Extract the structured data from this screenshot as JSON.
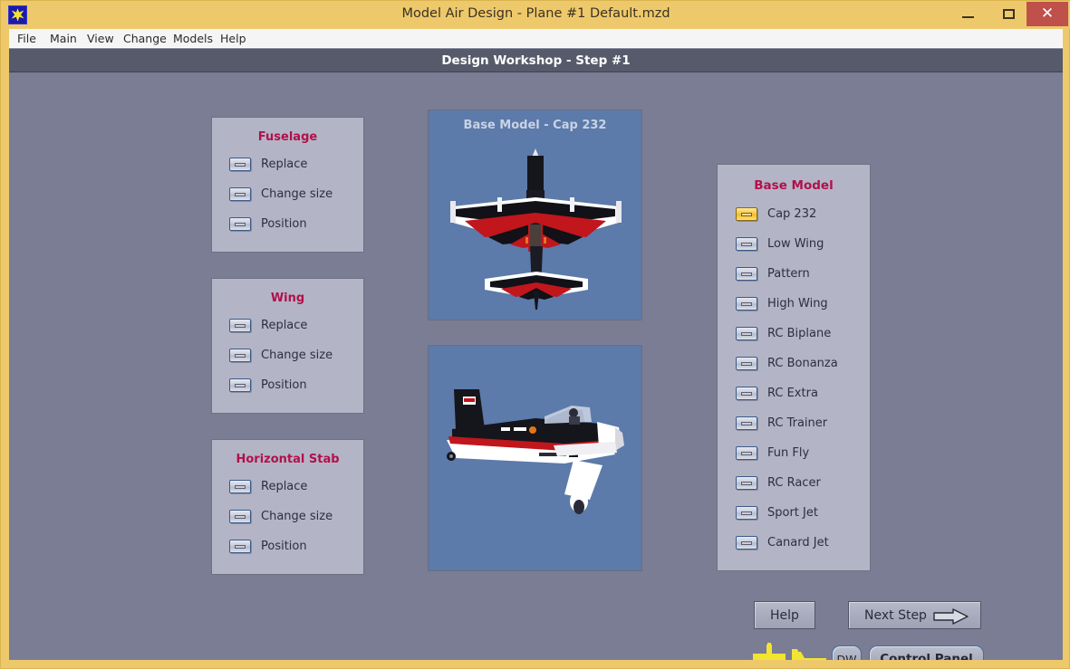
{
  "window": {
    "title": "Model Air Design - Plane #1  Default.mzd",
    "app_icon": "airplane-icon",
    "minimize_label": "Minimize",
    "maximize_label": "Maximize",
    "close_label": "Close",
    "frame_color": "#eec96b",
    "close_button_color": "#c0504a"
  },
  "menubar": {
    "items": [
      {
        "label": "File"
      },
      {
        "label": "Main"
      },
      {
        "label": "View"
      },
      {
        "label": "Change"
      },
      {
        "label": "Models"
      },
      {
        "label": "Help"
      }
    ]
  },
  "step_header": {
    "text": "Design Workshop  -  Step #1",
    "background": "#565a6b"
  },
  "groups": [
    {
      "title": "Fuselage",
      "title_color": "#b2104b",
      "options": [
        {
          "label": "Replace"
        },
        {
          "label": "Change size"
        },
        {
          "label": "Position"
        }
      ]
    },
    {
      "title": "Wing",
      "title_color": "#b2104b",
      "options": [
        {
          "label": "Replace"
        },
        {
          "label": "Change size"
        },
        {
          "label": "Position"
        }
      ]
    },
    {
      "title": "Horizontal Stab",
      "title_color": "#b2104b",
      "options": [
        {
          "label": "Replace"
        },
        {
          "label": "Change size"
        },
        {
          "label": "Position"
        }
      ]
    }
  ],
  "previews": {
    "top_view": {
      "caption": "Base Model - Cap 232",
      "background": "#5c7aaa",
      "view": "top-view-aircraft"
    },
    "side_view": {
      "caption": "",
      "background": "#5c7aaa",
      "view": "side-view-aircraft"
    }
  },
  "base_model": {
    "title": "Base Model",
    "title_color": "#b2104b",
    "selected": "Cap 232",
    "selected_color": "#f5c842",
    "items": [
      {
        "label": "Cap 232",
        "selected": true
      },
      {
        "label": "Low Wing",
        "selected": false
      },
      {
        "label": "Pattern",
        "selected": false
      },
      {
        "label": "High Wing",
        "selected": false
      },
      {
        "label": "RC Biplane",
        "selected": false
      },
      {
        "label": "RC Bonanza",
        "selected": false
      },
      {
        "label": "RC Extra",
        "selected": false
      },
      {
        "label": "RC Trainer",
        "selected": false
      },
      {
        "label": "Fun Fly",
        "selected": false
      },
      {
        "label": "RC Racer",
        "selected": false
      },
      {
        "label": "Sport Jet",
        "selected": false
      },
      {
        "label": "Canard Jet",
        "selected": false
      }
    ]
  },
  "actions": {
    "help_label": "Help",
    "next_step_label": "Next Step",
    "next_step_icon": "arrow-right-icon",
    "dw_label": "DW",
    "control_panel_label": "Control Panel",
    "plane_top_icon": "airplane-top-view-icon",
    "plane_side_icon": "airplane-side-view-icon"
  }
}
